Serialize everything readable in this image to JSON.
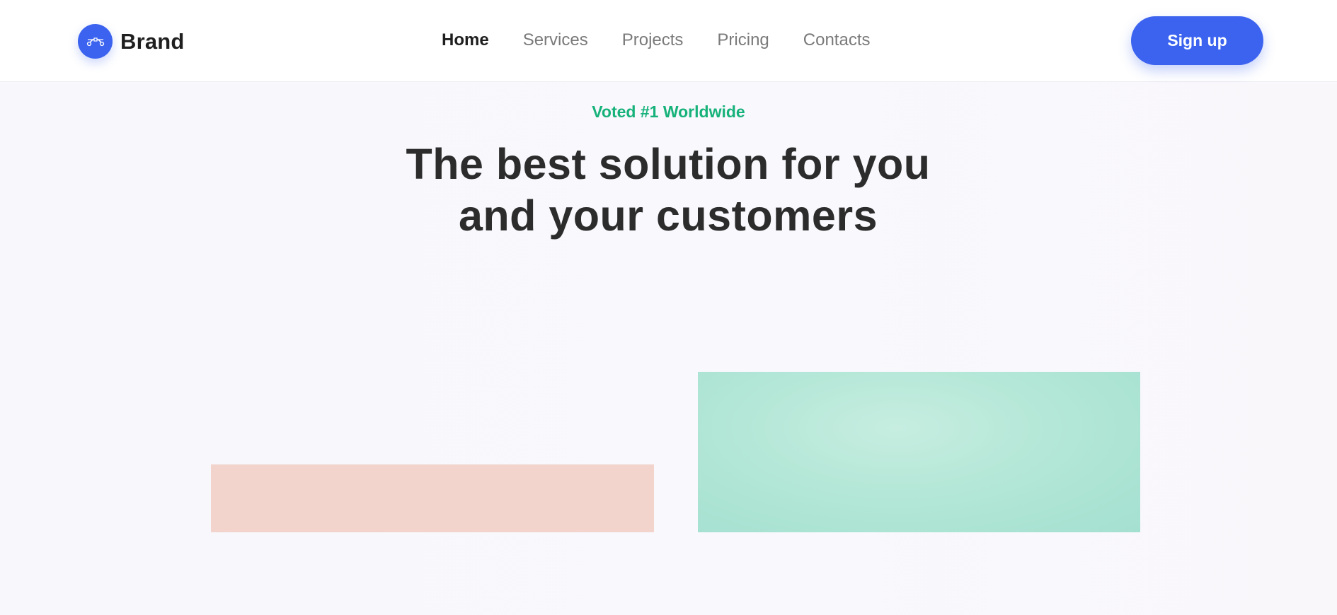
{
  "navbar": {
    "brand": {
      "name": "Brand",
      "logo_icon": "bezier-curve-icon"
    },
    "links": [
      {
        "label": "Home",
        "active": true
      },
      {
        "label": "Services",
        "active": false
      },
      {
        "label": "Projects",
        "active": false
      },
      {
        "label": "Pricing",
        "active": false
      },
      {
        "label": "Contacts",
        "active": false
      }
    ],
    "signup_label": "Sign up"
  },
  "hero": {
    "eyebrow": "Voted #1 Worldwide",
    "headline_line1": "The best solution for you",
    "headline_line2": "and your customers"
  },
  "colors": {
    "accent": "#3b63ef",
    "eyebrow": "#17b27a",
    "heading": "#2c2c2c",
    "background": "#f8f8fd",
    "image_pink": "#f2d4cd",
    "image_mint": "#b4e7d7"
  }
}
